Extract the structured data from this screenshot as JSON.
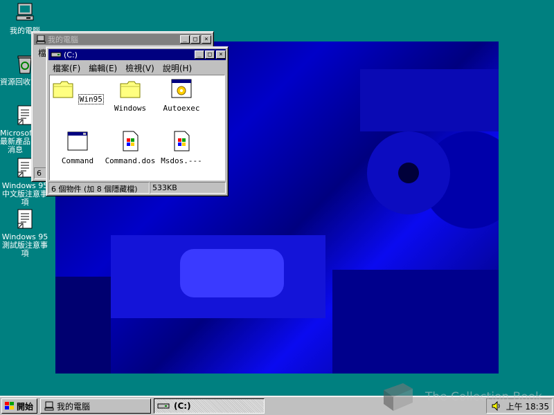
{
  "desktop": {
    "icons": [
      {
        "label": "我的電腦",
        "icon": "my-computer-icon"
      },
      {
        "label": "資源回收筒",
        "icon": "recycle-bin-icon"
      },
      {
        "label": "Microsoft 最新產品消息",
        "icon": "document-shortcut-icon"
      },
      {
        "label": "Windows 95 中文版注意事項",
        "icon": "document-shortcut-icon"
      },
      {
        "label": "Windows 95 測試版注意事項",
        "icon": "document-shortcut-icon"
      }
    ]
  },
  "window_back": {
    "title": "我的電腦",
    "menu_first": "檔",
    "status": "6"
  },
  "window_front": {
    "title": "(C:)",
    "menu": [
      "檔案(F)",
      "編輯(E)",
      "檢視(V)",
      "說明(H)"
    ],
    "items": [
      {
        "label": "Win95",
        "icon": "folder-icon"
      },
      {
        "label": "Windows",
        "icon": "folder-icon"
      },
      {
        "label": "Autoexec",
        "icon": "settings-file-icon"
      },
      {
        "label": "Command",
        "icon": "application-icon"
      },
      {
        "label": "Command.dos",
        "icon": "windows-file-icon"
      },
      {
        "label": "Msdos.---",
        "icon": "windows-file-icon"
      }
    ],
    "status_count": "6 個物件 (加 8 個隱藏檔)",
    "status_size": "533KB"
  },
  "taskbar": {
    "start_label": "開始",
    "tasks": [
      {
        "label": "我的電腦",
        "icon": "my-computer-icon"
      },
      {
        "label": "(C:)",
        "icon": "drive-icon"
      }
    ],
    "clock": "上午 18:35"
  },
  "watermark": "The Collection Book",
  "colors": {
    "desktop": "#008080",
    "title_active": "#000080",
    "title_inactive": "#808080",
    "face": "#c0c0c0"
  }
}
